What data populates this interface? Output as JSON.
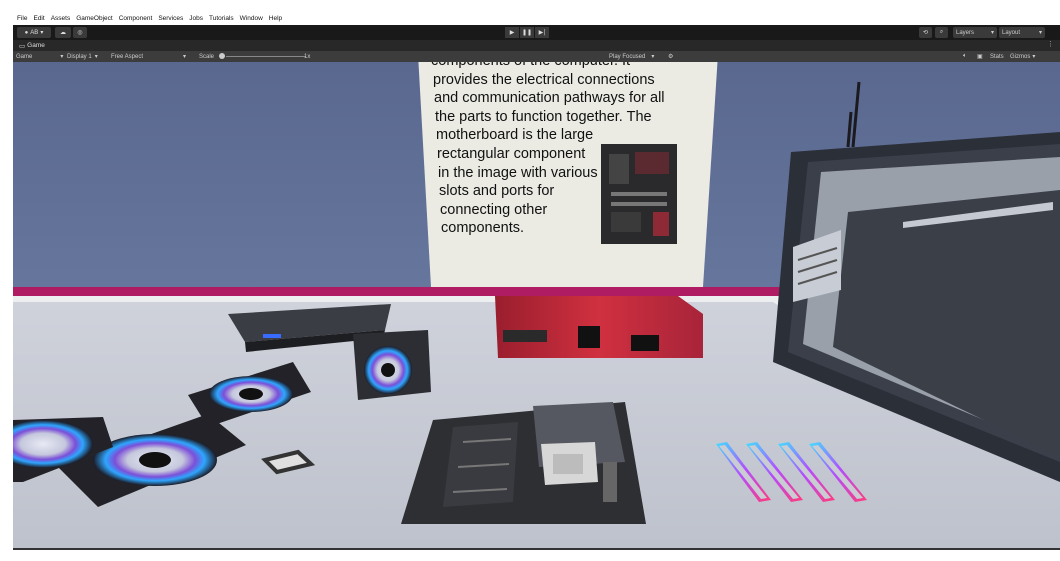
{
  "menu": [
    "File",
    "Edit",
    "Assets",
    "GameObject",
    "Component",
    "Services",
    "Jobs",
    "Tutorials",
    "Window",
    "Help"
  ],
  "toolbar": {
    "account_label": "AB",
    "layers_label": "Layers",
    "layout_label": "Layout"
  },
  "tab": {
    "label": "Game"
  },
  "gamebar": {
    "mode": "Game",
    "display": "Display 1",
    "aspect": "Free Aspect",
    "scale_label": "Scale",
    "scale_value": "1x",
    "play_mode": "Play Focused",
    "stats": "Stats",
    "gizmos": "Gizmos"
  },
  "poster": {
    "lines": [
      "components of the computer. It",
      "provides the electrical connections",
      "and communication pathways for all",
      "the parts to function together. The",
      "motherboard is the large",
      "rectangular component",
      "in the image with various",
      "slots and ports for",
      "connecting other",
      "components."
    ]
  },
  "colors": {
    "wall": "#5d6d93",
    "floor": "#eceeef",
    "table": "#c4c8d2",
    "stripe": "#b01c63",
    "poster": "#ebebe4"
  }
}
